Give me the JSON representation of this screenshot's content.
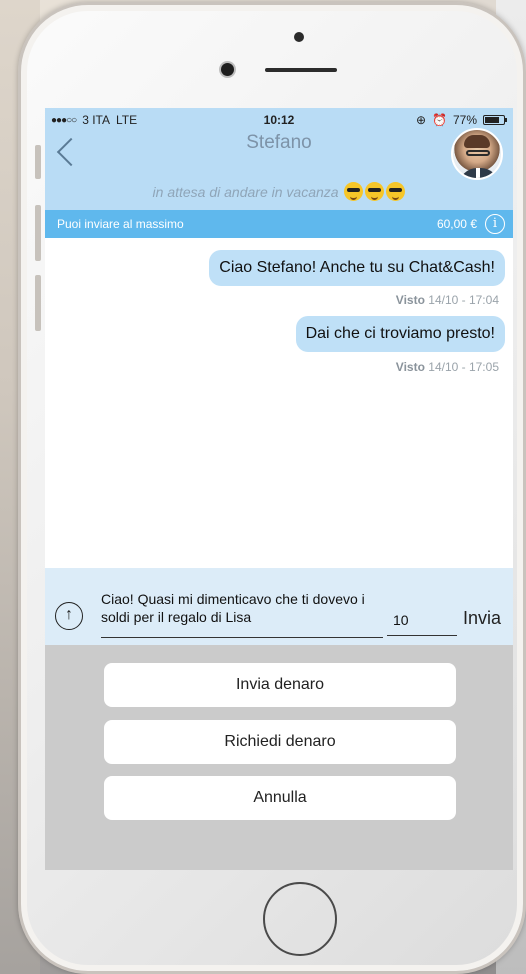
{
  "status_bar": {
    "carrier": "3 ITA",
    "network": "LTE",
    "time": "10:12",
    "battery": "77%",
    "battery_level": 0.77
  },
  "chat_header": {
    "contact_name": "Stefano",
    "tagline": "in attesa di andare in vacanza"
  },
  "limit_bar": {
    "label": "Puoi inviare al massimo",
    "amount": "60,00 €",
    "info_icon": "i"
  },
  "messages": [
    {
      "text": "Ciao Stefano! Anche tu su Chat&Cash!",
      "seen_label": "Visto",
      "seen_time": "14/10 - 17:04"
    },
    {
      "text": "Dai che ci troviamo presto!",
      "seen_label": "Visto",
      "seen_time": "14/10 - 17:05"
    }
  ],
  "composer": {
    "message_value": "Ciao! Quasi mi dimenticavo che ti dovevo i soldi per il regalo di Lisa",
    "amount_value": "10",
    "send_label": "Invia",
    "upload_icon": "↑"
  },
  "action_sheet": {
    "send_money": "Invia denaro",
    "request_money": "Richiedi denaro",
    "cancel": "Annulla"
  },
  "colors": {
    "header_bg": "#b9dcf5",
    "limit_bar_bg": "#5fb8ed",
    "bubble_bg": "#bfe0f7",
    "composer_bg": "#dcecf8",
    "sheet_bg": "#cbcbcb"
  }
}
